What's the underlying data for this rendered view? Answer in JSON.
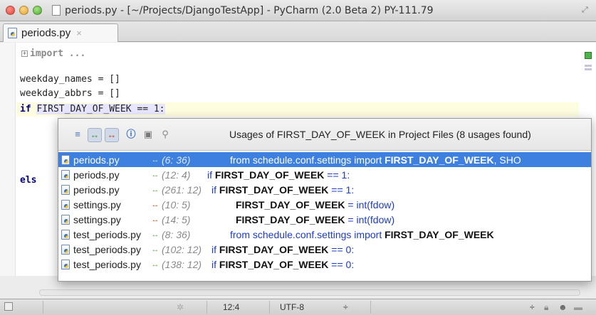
{
  "window": {
    "title": "periods.py - [~/Projects/DjangoTestApp] - PyCharm (2.0 Beta 2) PY-111.79"
  },
  "tab": {
    "label": "periods.py",
    "close": "×"
  },
  "editor": {
    "fold_label": "import ...",
    "lines": [
      "weekday_names = []",
      "weekday_abbrs = []"
    ],
    "if_keyword": "if",
    "if_rest": "FIRST_DAY_OF_WEEK == 1:",
    "else_fragment": "els"
  },
  "usages": {
    "title": "Usages of FIRST_DAY_OF_WEEK in Project Files (8 usages found)",
    "rows": [
      {
        "file": "periods.py",
        "pos": "(6: 36)",
        "kind": "read",
        "pre": "from schedule.conf.settings import ",
        "bold": "FIRST_DAY_OF_WEEK",
        "post": ", SHO"
      },
      {
        "file": "periods.py",
        "pos": "(12: 4)",
        "kind": "read",
        "pre": "if ",
        "bold": "FIRST_DAY_OF_WEEK",
        "post": " == 1:"
      },
      {
        "file": "periods.py",
        "pos": "(261: 12)",
        "kind": "read",
        "pre": "if ",
        "bold": "FIRST_DAY_OF_WEEK",
        "post": " == 1:"
      },
      {
        "file": "settings.py",
        "pos": "(10: 5)",
        "kind": "write",
        "pre": "",
        "bold": "FIRST_DAY_OF_WEEK",
        "post": " = int(fdow)"
      },
      {
        "file": "settings.py",
        "pos": "(14: 5)",
        "kind": "write",
        "pre": "",
        "bold": "FIRST_DAY_OF_WEEK",
        "post": " = int(fdow)"
      },
      {
        "file": "test_periods.py",
        "pos": "(8: 36)",
        "kind": "read",
        "pre": "from schedule.conf.settings import ",
        "bold": "FIRST_DAY_OF_WEEK",
        "post": ""
      },
      {
        "file": "test_periods.py",
        "pos": "(102: 12)",
        "kind": "read",
        "pre": "if ",
        "bold": "FIRST_DAY_OF_WEEK",
        "post": " == 0:"
      },
      {
        "file": "test_periods.py",
        "pos": "(138: 12)",
        "kind": "read",
        "pre": "if ",
        "bold": "FIRST_DAY_OF_WEEK",
        "post": " == 0:"
      }
    ]
  },
  "status": {
    "position": "12:4",
    "encoding": "UTF-8",
    "encoding_arrow": "÷",
    "lock_arrow": "÷"
  },
  "colors": {
    "selection": "#3d80df",
    "read_arrow": "#6aab5b",
    "write_arrow": "#d05a3c"
  }
}
